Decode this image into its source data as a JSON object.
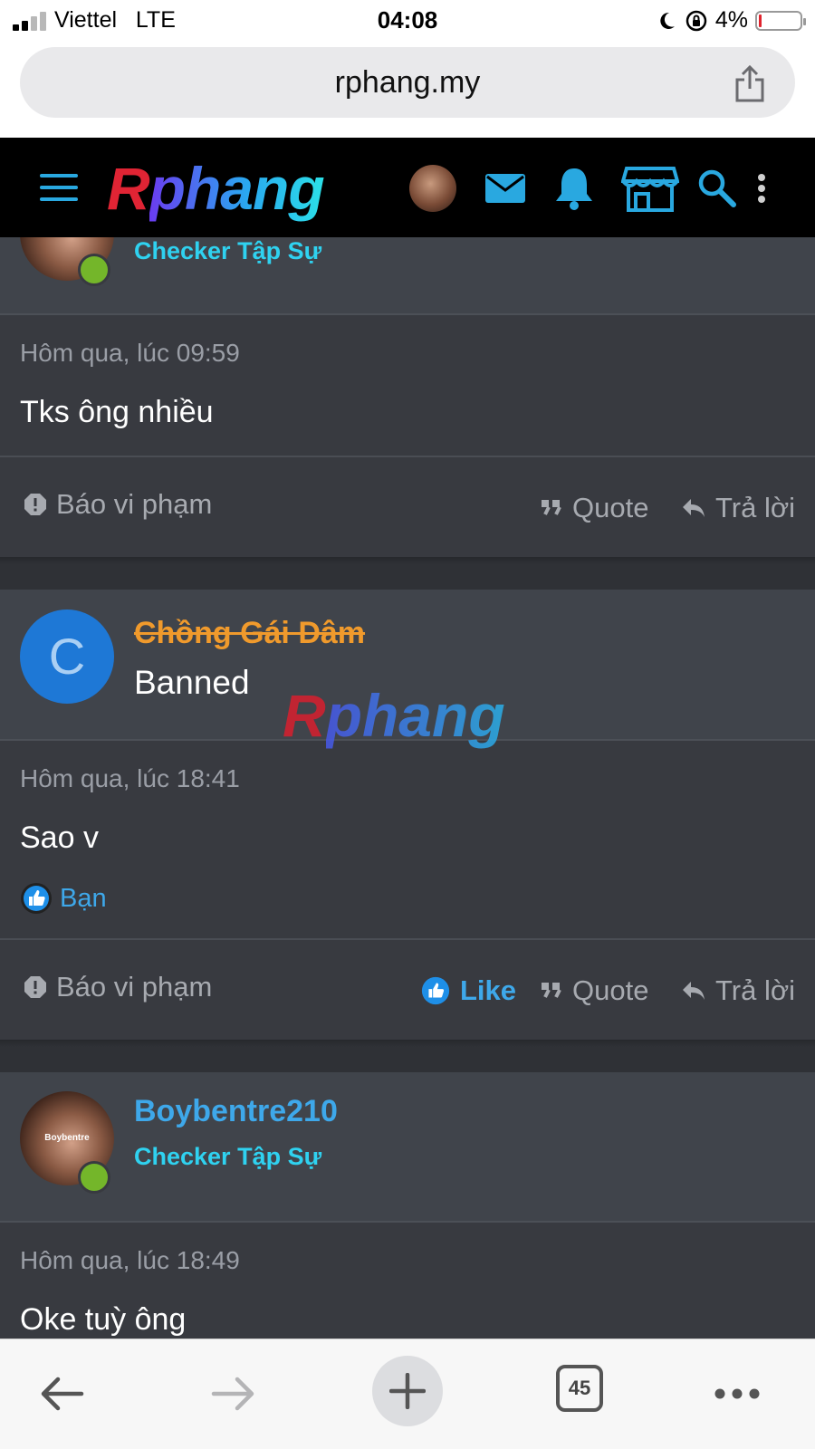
{
  "status_bar": {
    "carrier": "Viettel",
    "network": "LTE",
    "time": "04:08",
    "battery_percent": "4%",
    "signal_bars_filled": 2,
    "signal_bars_total": 4
  },
  "browser": {
    "url": "rphang.my",
    "share_icon": "share-icon"
  },
  "site_nav": {
    "logo_first": "R",
    "logo_rest": "phang",
    "icons": [
      "menu-icon",
      "avatar",
      "mail-icon",
      "bell-icon",
      "store-icon",
      "search-icon",
      "more-vertical-icon"
    ],
    "accent": "#29a8e0"
  },
  "posts": [
    {
      "author_title": "Checker Tập Sự",
      "timestamp": "Hôm qua, lúc 09:59",
      "message": "Tks ông nhiều",
      "actions": {
        "report": "Báo vi phạm",
        "quote": "Quote",
        "reply": "Trả lời"
      }
    },
    {
      "avatar_letter": "C",
      "author": "Chồng Gái Dâm",
      "author_title": "Banned",
      "watermark_first": "R",
      "watermark_rest": "phang",
      "timestamp": "Hôm qua, lúc 18:41",
      "message": "Sao v",
      "reaction_text": "Bạn",
      "actions": {
        "report": "Báo vi phạm",
        "like": "Like",
        "quote": "Quote",
        "reply": "Trả lời"
      }
    },
    {
      "author": "Boybentre210",
      "author_title": "Checker Tập Sự",
      "avatar_watermark": "Boybentre",
      "timestamp": "Hôm qua, lúc 18:49",
      "message": "Oke tuỳ ông"
    }
  ],
  "bottom_toolbar": {
    "tab_count": "45",
    "icons": [
      "back-arrow-icon",
      "forward-arrow-icon",
      "plus-icon",
      "tabs-icon",
      "more-horizontal-icon"
    ]
  },
  "colors": {
    "username": "#3ea8ea",
    "user_title": "#2fd2f0",
    "banned_name": "#f09a2c",
    "online": "#74b62a",
    "card_bg": "#383a40",
    "header_bg": "#40444b"
  }
}
